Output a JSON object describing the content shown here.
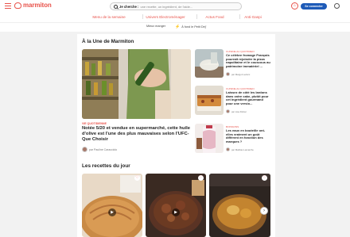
{
  "header": {
    "logo_text": "marmiton",
    "search": {
      "label": "Je cherche :",
      "placeholder": "une recette, un ingrédient, de l'aide..."
    },
    "login_label": "Se connecter"
  },
  "nav": {
    "items": [
      {
        "label": "Menu de la semaine"
      },
      {
        "label": "Univers Electroménager"
      },
      {
        "label": "Actus Food"
      },
      {
        "label": "Anti-Gaspi"
      }
    ],
    "sub_items": [
      {
        "label": "Mieux manger"
      },
      {
        "label": "À fond le Petit Déj'"
      }
    ]
  },
  "une": {
    "title": "À la Une de Marmiton",
    "main": {
      "category": "VIE QUOTIDIENNE",
      "title": "Notée 5/20 et vendue en supermarché, cette huile d'olive est l'une des plus mauvaises selon l'UFC-Que Choisir",
      "author": "par Pauline Caracciolo"
    },
    "side": [
      {
        "category": "CUISINE AU QUOTIDIEN",
        "title": "Ce célèbre fromage Français pourrait rejoindre la pizza napolitaine et le couscous au patrimoine immatériel ...",
        "author": "par Margot Leclerc"
      },
      {
        "category": "CUISINE AU QUOTIDIEN",
        "title": "Laissez de côté les lardons dans votre cake, plutôt pour cet ingrédient gourmand pour une versio...",
        "author": "par Lisa Dufour"
      },
      {
        "category": "BOISSONS",
        "title": "Les eaux en bouteille ont-elles vraiment un goût différent en fonction des marques ?",
        "author": "par Mathias Lamarche"
      }
    ]
  },
  "recettes": {
    "title": "Les recettes du jour"
  }
}
